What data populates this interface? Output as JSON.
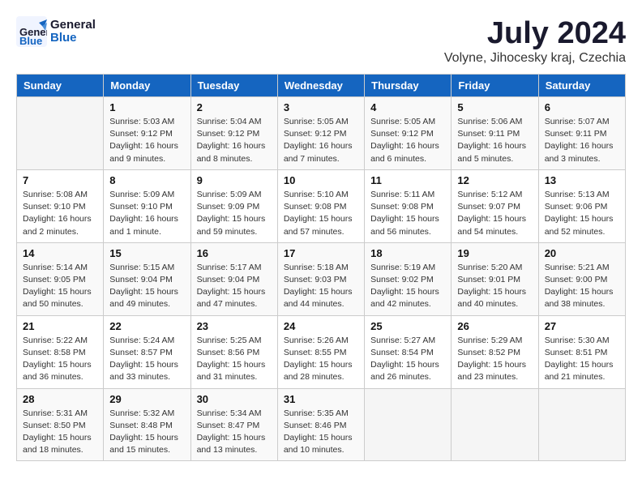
{
  "header": {
    "logo_general": "General",
    "logo_blue": "Blue",
    "month_title": "July 2024",
    "location": "Volyne, Jihocesky kraj, Czechia"
  },
  "columns": [
    "Sunday",
    "Monday",
    "Tuesday",
    "Wednesday",
    "Thursday",
    "Friday",
    "Saturday"
  ],
  "weeks": [
    [
      {
        "day": "",
        "info": ""
      },
      {
        "day": "1",
        "info": "Sunrise: 5:03 AM\nSunset: 9:12 PM\nDaylight: 16 hours\nand 9 minutes."
      },
      {
        "day": "2",
        "info": "Sunrise: 5:04 AM\nSunset: 9:12 PM\nDaylight: 16 hours\nand 8 minutes."
      },
      {
        "day": "3",
        "info": "Sunrise: 5:05 AM\nSunset: 9:12 PM\nDaylight: 16 hours\nand 7 minutes."
      },
      {
        "day": "4",
        "info": "Sunrise: 5:05 AM\nSunset: 9:12 PM\nDaylight: 16 hours\nand 6 minutes."
      },
      {
        "day": "5",
        "info": "Sunrise: 5:06 AM\nSunset: 9:11 PM\nDaylight: 16 hours\nand 5 minutes."
      },
      {
        "day": "6",
        "info": "Sunrise: 5:07 AM\nSunset: 9:11 PM\nDaylight: 16 hours\nand 3 minutes."
      }
    ],
    [
      {
        "day": "7",
        "info": "Sunrise: 5:08 AM\nSunset: 9:10 PM\nDaylight: 16 hours\nand 2 minutes."
      },
      {
        "day": "8",
        "info": "Sunrise: 5:09 AM\nSunset: 9:10 PM\nDaylight: 16 hours\nand 1 minute."
      },
      {
        "day": "9",
        "info": "Sunrise: 5:09 AM\nSunset: 9:09 PM\nDaylight: 15 hours\nand 59 minutes."
      },
      {
        "day": "10",
        "info": "Sunrise: 5:10 AM\nSunset: 9:08 PM\nDaylight: 15 hours\nand 57 minutes."
      },
      {
        "day": "11",
        "info": "Sunrise: 5:11 AM\nSunset: 9:08 PM\nDaylight: 15 hours\nand 56 minutes."
      },
      {
        "day": "12",
        "info": "Sunrise: 5:12 AM\nSunset: 9:07 PM\nDaylight: 15 hours\nand 54 minutes."
      },
      {
        "day": "13",
        "info": "Sunrise: 5:13 AM\nSunset: 9:06 PM\nDaylight: 15 hours\nand 52 minutes."
      }
    ],
    [
      {
        "day": "14",
        "info": "Sunrise: 5:14 AM\nSunset: 9:05 PM\nDaylight: 15 hours\nand 50 minutes."
      },
      {
        "day": "15",
        "info": "Sunrise: 5:15 AM\nSunset: 9:04 PM\nDaylight: 15 hours\nand 49 minutes."
      },
      {
        "day": "16",
        "info": "Sunrise: 5:17 AM\nSunset: 9:04 PM\nDaylight: 15 hours\nand 47 minutes."
      },
      {
        "day": "17",
        "info": "Sunrise: 5:18 AM\nSunset: 9:03 PM\nDaylight: 15 hours\nand 44 minutes."
      },
      {
        "day": "18",
        "info": "Sunrise: 5:19 AM\nSunset: 9:02 PM\nDaylight: 15 hours\nand 42 minutes."
      },
      {
        "day": "19",
        "info": "Sunrise: 5:20 AM\nSunset: 9:01 PM\nDaylight: 15 hours\nand 40 minutes."
      },
      {
        "day": "20",
        "info": "Sunrise: 5:21 AM\nSunset: 9:00 PM\nDaylight: 15 hours\nand 38 minutes."
      }
    ],
    [
      {
        "day": "21",
        "info": "Sunrise: 5:22 AM\nSunset: 8:58 PM\nDaylight: 15 hours\nand 36 minutes."
      },
      {
        "day": "22",
        "info": "Sunrise: 5:24 AM\nSunset: 8:57 PM\nDaylight: 15 hours\nand 33 minutes."
      },
      {
        "day": "23",
        "info": "Sunrise: 5:25 AM\nSunset: 8:56 PM\nDaylight: 15 hours\nand 31 minutes."
      },
      {
        "day": "24",
        "info": "Sunrise: 5:26 AM\nSunset: 8:55 PM\nDaylight: 15 hours\nand 28 minutes."
      },
      {
        "day": "25",
        "info": "Sunrise: 5:27 AM\nSunset: 8:54 PM\nDaylight: 15 hours\nand 26 minutes."
      },
      {
        "day": "26",
        "info": "Sunrise: 5:29 AM\nSunset: 8:52 PM\nDaylight: 15 hours\nand 23 minutes."
      },
      {
        "day": "27",
        "info": "Sunrise: 5:30 AM\nSunset: 8:51 PM\nDaylight: 15 hours\nand 21 minutes."
      }
    ],
    [
      {
        "day": "28",
        "info": "Sunrise: 5:31 AM\nSunset: 8:50 PM\nDaylight: 15 hours\nand 18 minutes."
      },
      {
        "day": "29",
        "info": "Sunrise: 5:32 AM\nSunset: 8:48 PM\nDaylight: 15 hours\nand 15 minutes."
      },
      {
        "day": "30",
        "info": "Sunrise: 5:34 AM\nSunset: 8:47 PM\nDaylight: 15 hours\nand 13 minutes."
      },
      {
        "day": "31",
        "info": "Sunrise: 5:35 AM\nSunset: 8:46 PM\nDaylight: 15 hours\nand 10 minutes."
      },
      {
        "day": "",
        "info": ""
      },
      {
        "day": "",
        "info": ""
      },
      {
        "day": "",
        "info": ""
      }
    ]
  ]
}
